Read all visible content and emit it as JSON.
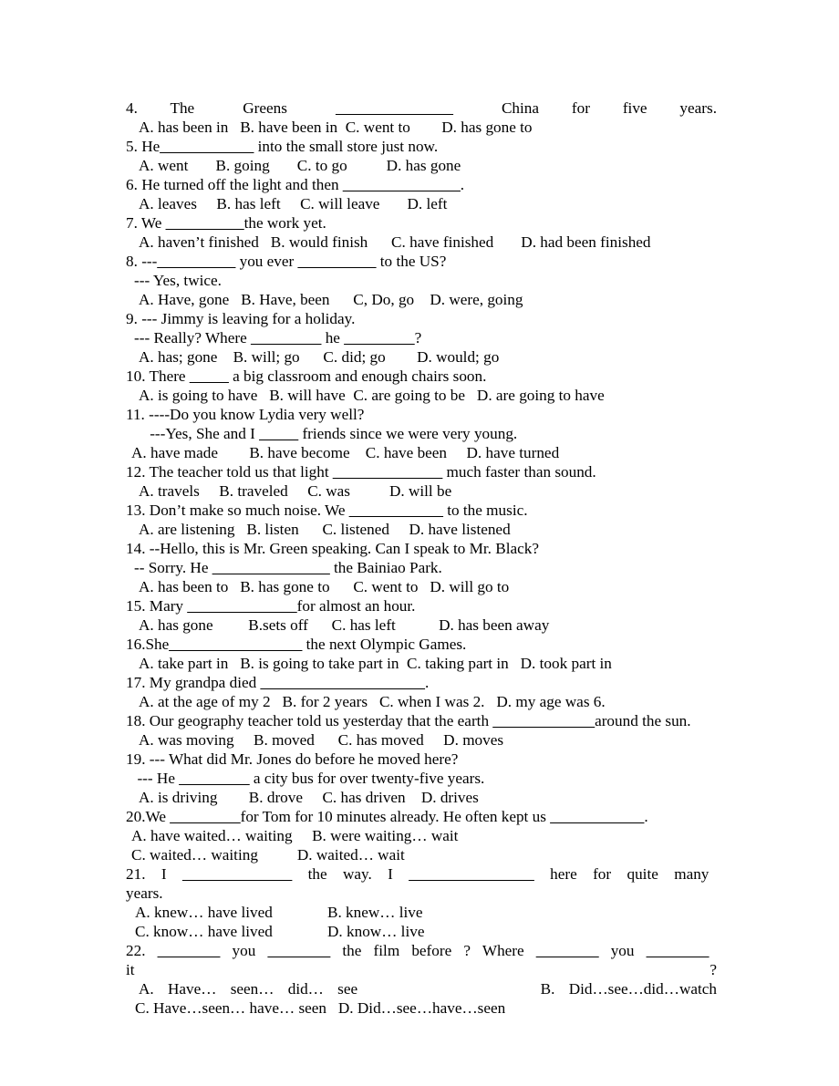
{
  "document": {
    "type": "grammar-worksheet",
    "language": "English",
    "blank": "______________"
  },
  "questions": [
    {
      "number": "4.",
      "stem_pre": "4.  The   Greens   ",
      "stem_blank": "_______________",
      "stem_post": "   China  for  five  years.",
      "stem_plain": "4. The Greens _______________ China for five years.",
      "justify": true,
      "option_lines": [
        "A. has been in   B. have been in  C. went to        D. has gone to"
      ]
    },
    {
      "number": "5.",
      "stem_pre": "5. He",
      "stem_blank": "____________",
      "stem_post": " into the small store just now.",
      "stem_plain": "5. He____________ into the small store just now.",
      "justify": false,
      "option_lines": [
        "A. went       B. going       C. to go          D. has gone"
      ]
    },
    {
      "number": "6.",
      "stem_pre": "6. He turned off the light and then ",
      "stem_blank": "_______________",
      "stem_post": ".",
      "stem_plain": "6. He turned off the light and then _______________.",
      "justify": false,
      "option_lines": [
        "A. leaves     B. has left     C. will leave       D. left"
      ]
    },
    {
      "number": "7.",
      "stem_pre": "7. We ",
      "stem_blank": "__________",
      "stem_post": "the work yet.",
      "stem_plain": "7. We __________the work yet.",
      "justify": false,
      "option_lines": [
        "A. haven’t finished   B. would finish      C. have finished       D. had been finished"
      ]
    },
    {
      "number": "8.",
      "stem_pre": "8. ---",
      "stem_blank": "__________",
      "stem_post": " you ever __________ to the US?",
      "stem_plain": "8. ---__________ you ever __________ to the US?",
      "justify": false,
      "reply": "--- Yes, twice.",
      "option_lines": [
        "A. Have, gone   B. Have, been      C, Do, go    D. were, going"
      ]
    },
    {
      "number": "9.",
      "stem_pre": "9. --- Jimmy is leaving for a holiday.",
      "stem_blank": "",
      "stem_post": "",
      "stem_plain": "9. --- Jimmy is leaving for a holiday.",
      "justify": false,
      "reply": "--- Really? Where _________ he _________?",
      "option_lines": [
        "A. has; gone    B. will; go      C. did; go        D. would; go"
      ]
    },
    {
      "number": "10.",
      "stem_pre": "10. There ",
      "stem_blank": "_____",
      "stem_post": " a big classroom and enough chairs soon.",
      "stem_plain": "10. There _____ a big classroom and enough chairs soon.",
      "justify": false,
      "option_lines": [
        "A. is going to have   B. will have  C. are going to be   D. are going to have"
      ]
    },
    {
      "number": "11.",
      "stem_pre": "11. ----Do you know Lydia very well?",
      "stem_blank": "",
      "stem_post": "",
      "stem_plain": "11. ----Do you know Lydia very well?",
      "justify": false,
      "reply": "   ---Yes, She and I _____ friends since we were very young.",
      "option_lines": [
        "A. have made        B. have become    C. have been     D. have turned"
      ]
    },
    {
      "number": "12.",
      "stem_pre": "12. The teacher told us that light ",
      "stem_blank": "______________",
      "stem_post": " much faster than sound.",
      "stem_plain": "12. The teacher told us that light ______________ much faster than sound.",
      "justify": false,
      "option_lines": [
        "A. travels     B. traveled     C. was          D. will be"
      ]
    },
    {
      "number": "13.",
      "stem_pre": "13. Don’t make so much noise. We ",
      "stem_blank": "____________",
      "stem_post": " to the music.",
      "stem_plain": "13. Don’t make so much noise. We ____________ to the music.",
      "justify": false,
      "option_lines": [
        "A. are listening   B. listen      C. listened     D. have listened"
      ]
    },
    {
      "number": "14.",
      "stem_pre": "14. --Hello, this is Mr. Green speaking. Can I speak to Mr. Black?",
      "stem_blank": "",
      "stem_post": "",
      "stem_plain": "14. --Hello, this is Mr. Green speaking. Can I speak to Mr. Black?",
      "justify": false,
      "reply": "-- Sorry. He _______________ the Bainiao Park.",
      "option_lines": [
        "A. has been to   B. has gone to      C. went to   D. will go to"
      ]
    },
    {
      "number": "15.",
      "stem_pre": "15. Mary ",
      "stem_blank": "______________",
      "stem_post": "for almost an hour.",
      "stem_plain": "15. Mary ______________for almost an hour.",
      "justify": false,
      "option_lines": [
        "A. has gone         B.sets off      C. has left           D. has been away"
      ]
    },
    {
      "number": "16.",
      "stem_pre": "16.She",
      "stem_blank": "_________________",
      "stem_post": " the next Olympic Games.",
      "stem_plain": "16.She_________________ the next Olympic Games.",
      "justify": false,
      "option_lines": [
        "A. take part in   B. is going to take part in  C. taking part in   D. took part in"
      ]
    },
    {
      "number": "17.",
      "stem_pre": "17. My grandpa died ",
      "stem_blank": "_____________________",
      "stem_post": ".",
      "stem_plain": "17. My grandpa died _____________________.",
      "justify": false,
      "option_lines": [
        "A. at the age of my 2   B. for 2 years   C. when I was 2.   D. my age was 6."
      ]
    },
    {
      "number": "18.",
      "stem_pre": "18. Our geography teacher told us yesterday that the earth ",
      "stem_blank": "_____________",
      "stem_post": "around the sun.",
      "stem_plain": "18. Our geography teacher told us yesterday that the earth _____________around the sun.",
      "justify": false,
      "option_lines": [
        "A. was moving     B. moved      C. has moved     D. moves"
      ]
    },
    {
      "number": "19.",
      "stem_pre": "19. --- What did Mr. Jones do before he moved here?",
      "stem_blank": "",
      "stem_post": "",
      "stem_plain": "19. --- What did Mr. Jones do before he moved here?",
      "justify": false,
      "reply": " --- He _________ a city bus for over twenty-five years.",
      "option_lines": [
        "A. is driving        B. drove     C. has driven    D. drives"
      ]
    },
    {
      "number": "20.",
      "stem_pre": "20.We ",
      "stem_blank": "_________",
      "stem_post": "for Tom for 10 minutes already. He often kept us ____________.",
      "stem_plain": "20.We _________for Tom for 10 minutes already. He often kept us ____________.",
      "justify": false,
      "option_lines": [
        "A. have waited… waiting     B. were waiting… wait",
        "C. waited… waiting          D. waited… wait"
      ]
    },
    {
      "number": "21.",
      "stem_pre": "21.  I  ",
      "stem_blank": "______________",
      "stem_post": "  the  way.  I  ________________  here  for  quite  many  years.",
      "stem_plain": "21. I ______________ the way. I ________________ here for quite many years.",
      "justify": true,
      "option_lines": [
        "A. knew… have lived              B. knew… live",
        "C. know… have lived              D. know… live"
      ]
    },
    {
      "number": "22.",
      "stem_pre": "22.  ________  you  ________  the  film  before  ?  Where  ________  you  ________  it  ?",
      "stem_blank": "",
      "stem_post": "",
      "stem_plain": "22. ________ you ________ the film before ? Where ________ you ________ it ?",
      "justify": true,
      "option_lines": [
        "A.  Have…  seen…  did…  see                              B.  Did…see…did…watch",
        "C. Have…seen… have… seen   D. Did…see…have…seen"
      ]
    }
  ]
}
